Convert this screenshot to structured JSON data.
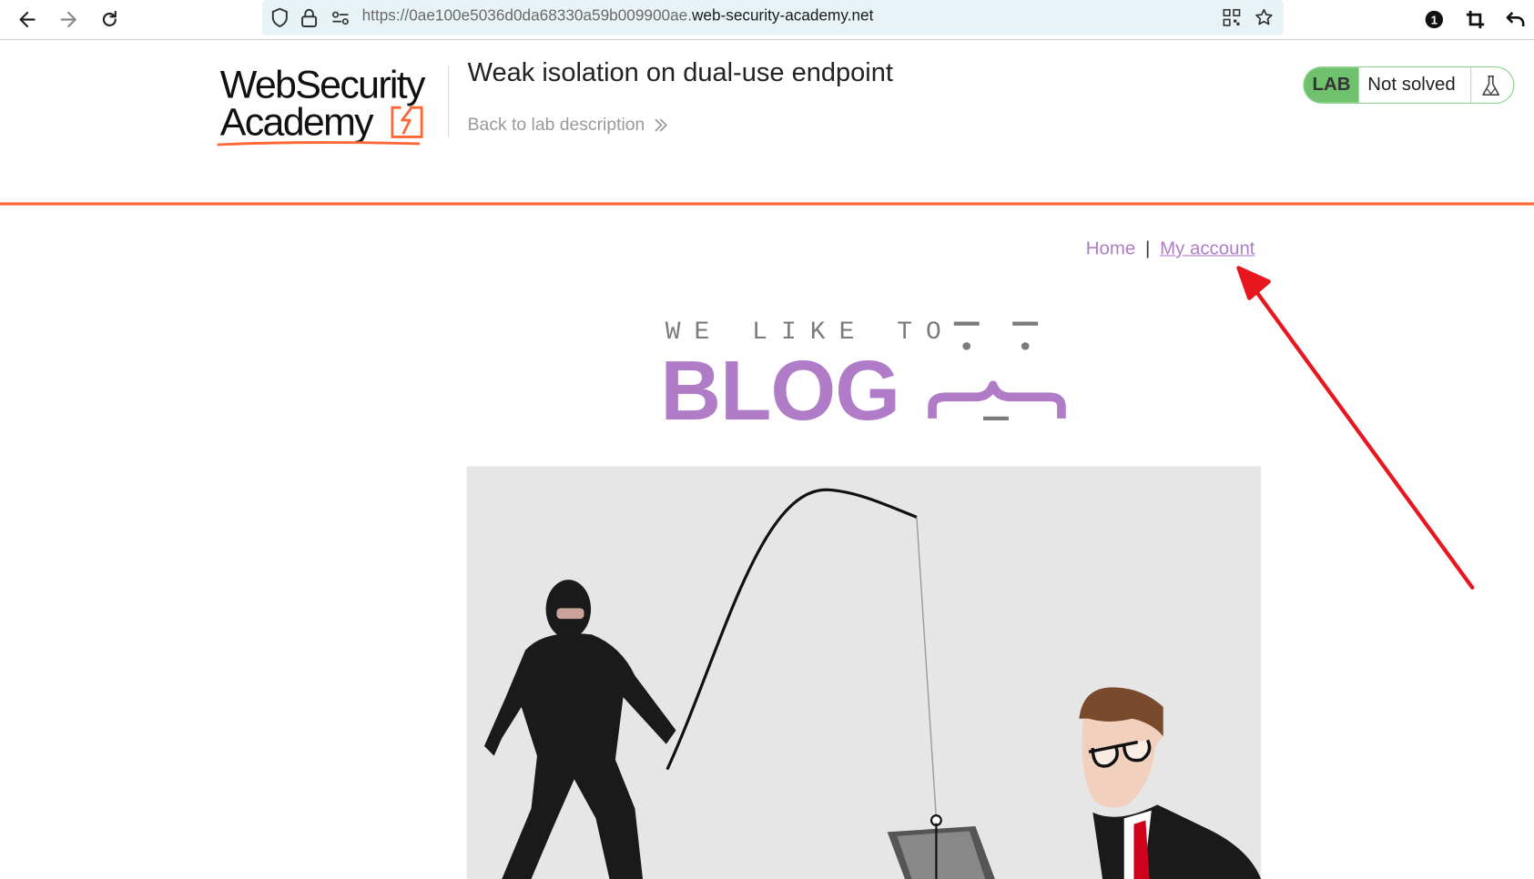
{
  "browser": {
    "url_prefix": "https://0ae100e5036d0da68330a59b009900ae.",
    "url_host": "web-security-academy.net",
    "icons": [
      "back-icon",
      "forward-icon",
      "reload-icon",
      "shield-icon",
      "lock-icon",
      "permissions-icon",
      "qr-code-icon",
      "bookmark-star-icon",
      "password-manager-icon",
      "crop-icon",
      "undo-icon"
    ],
    "extension_badge": "1"
  },
  "lab_header": {
    "logo_line1": "WebSecurity",
    "logo_line2": "Academy",
    "title": "Weak isolation on dual-use endpoint",
    "back_link": "Back to lab description",
    "status_tag": "LAB",
    "status_text": "Not solved",
    "accent_color": "#ff6633",
    "status_color": "#70c16d"
  },
  "blog": {
    "nav_home": "Home",
    "nav_separator": "|",
    "nav_account": "My account",
    "banner_small": "WE LIKE TO",
    "banner_big": "BLOG",
    "brand_color": "#b07cc8"
  }
}
